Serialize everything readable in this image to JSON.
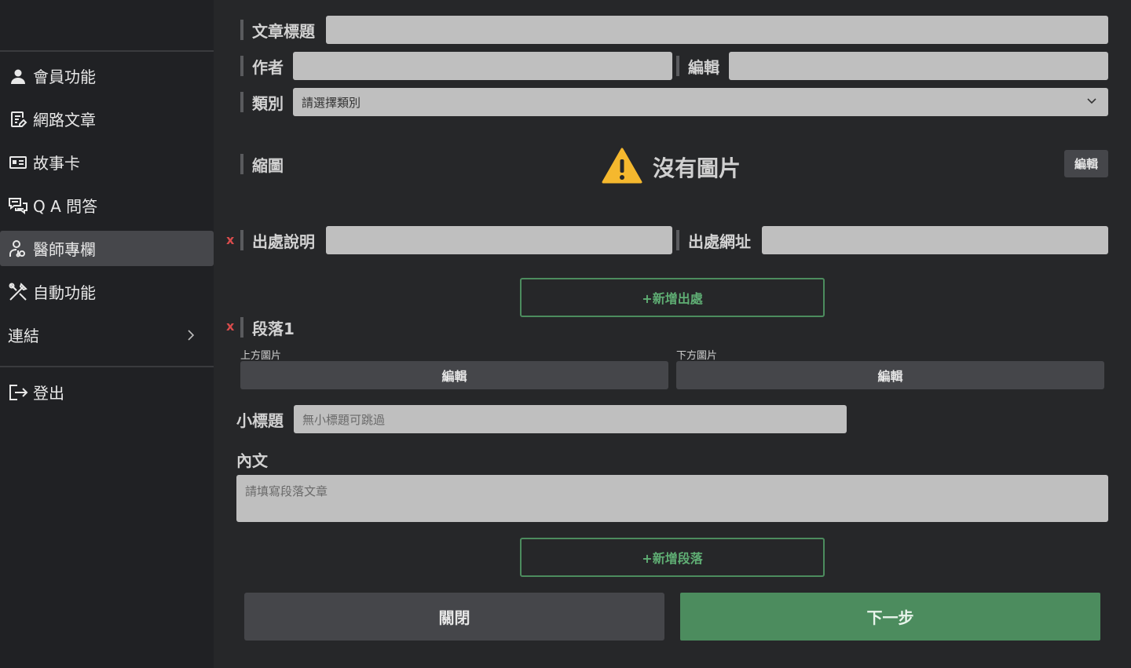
{
  "sidebar": {
    "items": [
      {
        "label": "會員功能",
        "icon": "user-icon"
      },
      {
        "label": "網路文章",
        "icon": "article-edit-icon"
      },
      {
        "label": "故事卡",
        "icon": "id-card-icon"
      },
      {
        "label": "Q A 問答",
        "icon": "chat-bubbles-icon"
      },
      {
        "label": "醫師專欄",
        "icon": "doctor-icon",
        "active": true
      },
      {
        "label": "自動功能",
        "icon": "tools-icon"
      },
      {
        "label": "連結",
        "icon": "chevron-right-icon"
      }
    ],
    "logout": {
      "label": "登出",
      "icon": "logout-icon"
    }
  },
  "form": {
    "title_label": "文章標題",
    "title_value": "",
    "author_label": "作者",
    "author_value": "",
    "editor_label": "編輯",
    "editor_value": "",
    "category_label": "類別",
    "category_selected": "請選擇類別",
    "thumbnail_label": "縮圖",
    "no_image_text": "沒有圖片",
    "thumbnail_edit_button": "編輯",
    "source_remove": "x",
    "source_desc_label": "出處說明",
    "source_desc_value": "",
    "source_url_label": "出處網址",
    "source_url_value": "",
    "add_source_button": "+新增出處",
    "paragraph_remove": "x",
    "paragraph_title": "段落1",
    "top_image_label": "上方圖片",
    "top_image_button": "編輯",
    "bottom_image_label": "下方圖片",
    "bottom_image_button": "編輯",
    "subtitle_label": "小標題",
    "subtitle_placeholder": "無小標題可跳過",
    "content_label": "內文",
    "content_placeholder": "請填寫段落文章",
    "add_paragraph_button": "+新增段落",
    "close_button": "關閉",
    "next_button": "下一步"
  },
  "colors": {
    "accent_green": "#4c8c5e",
    "remove_red": "#d94c4c",
    "warning_yellow": "#f5b82e"
  }
}
